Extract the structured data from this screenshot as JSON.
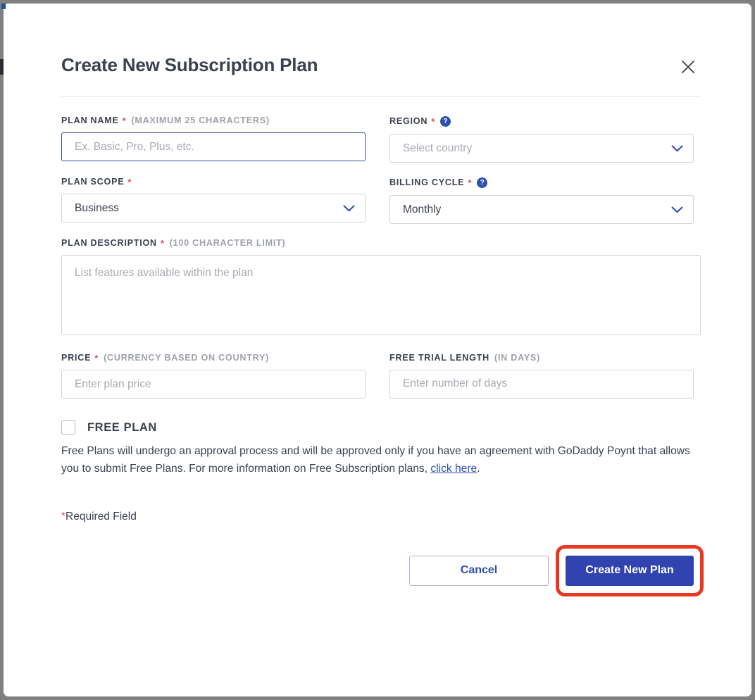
{
  "modal": {
    "title": "Create New Subscription Plan",
    "close_icon": "close-icon"
  },
  "form": {
    "plan_name": {
      "label": "PLAN NAME",
      "required_mark": "*",
      "hint": "(MAXIMUM 25 CHARACTERS)",
      "placeholder": "Ex. Basic, Pro, Plus, etc.",
      "value": ""
    },
    "region": {
      "label": "REGION",
      "required_mark": "*",
      "help_icon": "?",
      "placeholder": "Select country",
      "value": "Select country",
      "chevron_icon": "chevron-down-icon"
    },
    "plan_scope": {
      "label": "PLAN SCOPE",
      "required_mark": "*",
      "value": "Business",
      "chevron_icon": "chevron-down-icon"
    },
    "billing_cycle": {
      "label": "BILLING CYCLE",
      "required_mark": "*",
      "help_icon": "?",
      "value": "Monthly",
      "chevron_icon": "chevron-down-icon"
    },
    "plan_description": {
      "label": "PLAN DESCRIPTION",
      "required_mark": "*",
      "hint": "(100 CHARACTER LIMIT)",
      "placeholder": "List features available within the plan",
      "value": ""
    },
    "price": {
      "label": "PRICE",
      "required_mark": "*",
      "hint": "(CURRENCY BASED ON COUNTRY)",
      "placeholder": "Enter plan price",
      "value": ""
    },
    "free_trial_length": {
      "label": "FREE TRIAL LENGTH",
      "hint": "(IN DAYS)",
      "placeholder": "Enter number of days",
      "value": ""
    },
    "free_plan": {
      "label": "FREE PLAN",
      "checked": false,
      "description_part1": "Free Plans will undergo an approval process and will be approved only if you have an agreement with GoDaddy Poynt that allows you to submit Free Plans. For more information on Free Subscription plans, ",
      "link_text": "click here",
      "description_part2": "."
    },
    "required_note": {
      "star": "*",
      "text": "Required Field"
    }
  },
  "footer": {
    "cancel_label": "Cancel",
    "submit_label": "Create New Plan"
  },
  "colors": {
    "primary_blue": "#3043ae",
    "link_blue": "#2d4fb0",
    "required_red": "#d9534f",
    "highlight_ring": "#e8381f",
    "text_dark": "#3b4150",
    "placeholder_gray": "#a9abb3",
    "border_gray": "#d3d5da",
    "page_backdrop": "#808080"
  }
}
